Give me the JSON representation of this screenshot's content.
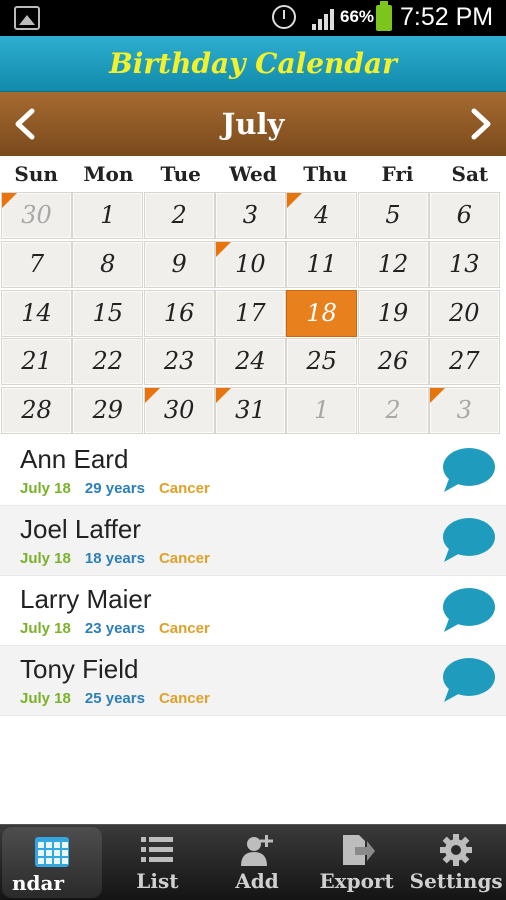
{
  "status_bar": {
    "battery_percent": "66%",
    "time": "7:52 PM",
    "icons": [
      "gallery-icon",
      "alarm-icon",
      "signal-icon",
      "battery-icon"
    ]
  },
  "app": {
    "title": "Birthday Calendar",
    "title_color": "#f4f02a",
    "header_color": "#1a9ec0",
    "month_bar_color": "#8c5826",
    "today_color": "#e8801e",
    "marker_color": "#e8740e"
  },
  "calendar": {
    "month": "July",
    "weekdays": [
      "Sun",
      "Mon",
      "Tue",
      "Wed",
      "Thu",
      "Fri",
      "Sat"
    ],
    "weeks": [
      [
        {
          "d": "30",
          "other": true,
          "mark": true
        },
        {
          "d": "1"
        },
        {
          "d": "2"
        },
        {
          "d": "3"
        },
        {
          "d": "4",
          "mark": true
        },
        {
          "d": "5"
        },
        {
          "d": "6"
        }
      ],
      [
        {
          "d": "7"
        },
        {
          "d": "8"
        },
        {
          "d": "9"
        },
        {
          "d": "10",
          "mark": true
        },
        {
          "d": "11"
        },
        {
          "d": "12"
        },
        {
          "d": "13"
        }
      ],
      [
        {
          "d": "14"
        },
        {
          "d": "15"
        },
        {
          "d": "16"
        },
        {
          "d": "17"
        },
        {
          "d": "18",
          "today": true
        },
        {
          "d": "19"
        },
        {
          "d": "20"
        }
      ],
      [
        {
          "d": "21"
        },
        {
          "d": "22"
        },
        {
          "d": "23"
        },
        {
          "d": "24"
        },
        {
          "d": "25"
        },
        {
          "d": "26"
        },
        {
          "d": "27"
        }
      ],
      [
        {
          "d": "28"
        },
        {
          "d": "29"
        },
        {
          "d": "30",
          "mark": true
        },
        {
          "d": "31",
          "mark": true
        },
        {
          "d": "1",
          "other": true
        },
        {
          "d": "2",
          "other": true
        },
        {
          "d": "3",
          "other": true,
          "mark": true
        }
      ]
    ]
  },
  "birthdays": [
    {
      "name": "Ann Eard",
      "date": "July 18",
      "age": "29 years",
      "sign": "Cancer"
    },
    {
      "name": "Joel Laffer",
      "date": "July 18",
      "age": "18 years",
      "sign": "Cancer"
    },
    {
      "name": "Larry Maier",
      "date": "July 18",
      "age": "23 years",
      "sign": "Cancer"
    },
    {
      "name": "Tony Field",
      "date": "July 18",
      "age": "25 years",
      "sign": "Cancer"
    }
  ],
  "bottom_nav": [
    {
      "label": "ndar",
      "icon": "calendar-icon",
      "active": true
    },
    {
      "label": "List",
      "icon": "list-icon"
    },
    {
      "label": "Add",
      "icon": "add-person-icon"
    },
    {
      "label": "Export",
      "icon": "export-icon"
    },
    {
      "label": "Settings",
      "icon": "gear-icon"
    }
  ]
}
